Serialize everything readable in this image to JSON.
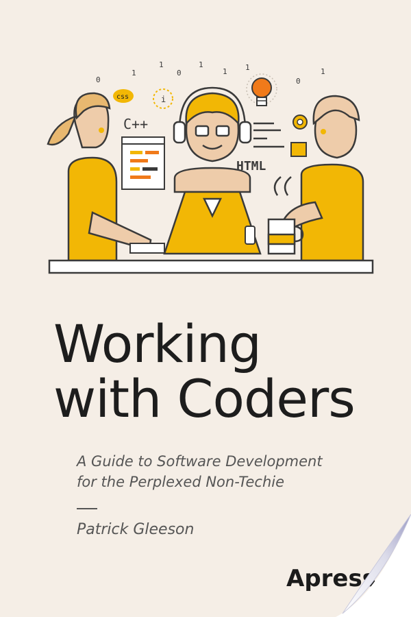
{
  "book": {
    "title_line1": "Working",
    "title_line2": "with Coders",
    "subtitle_line1": "A Guide to Software Development",
    "subtitle_line2": "for the Perplexed Non-Techie",
    "author": "Patrick Gleeson",
    "publisher": "Apress"
  },
  "illustration": {
    "code_labels": [
      "C++",
      "HTML",
      "css"
    ],
    "binary_digits": [
      "0",
      "1",
      "1",
      "0",
      "1",
      "1",
      "1",
      "0",
      "1"
    ]
  },
  "colors": {
    "background": "#f5eee6",
    "accent": "#f2b705",
    "line": "#3a3a3a",
    "skin": "#eeccaa"
  }
}
